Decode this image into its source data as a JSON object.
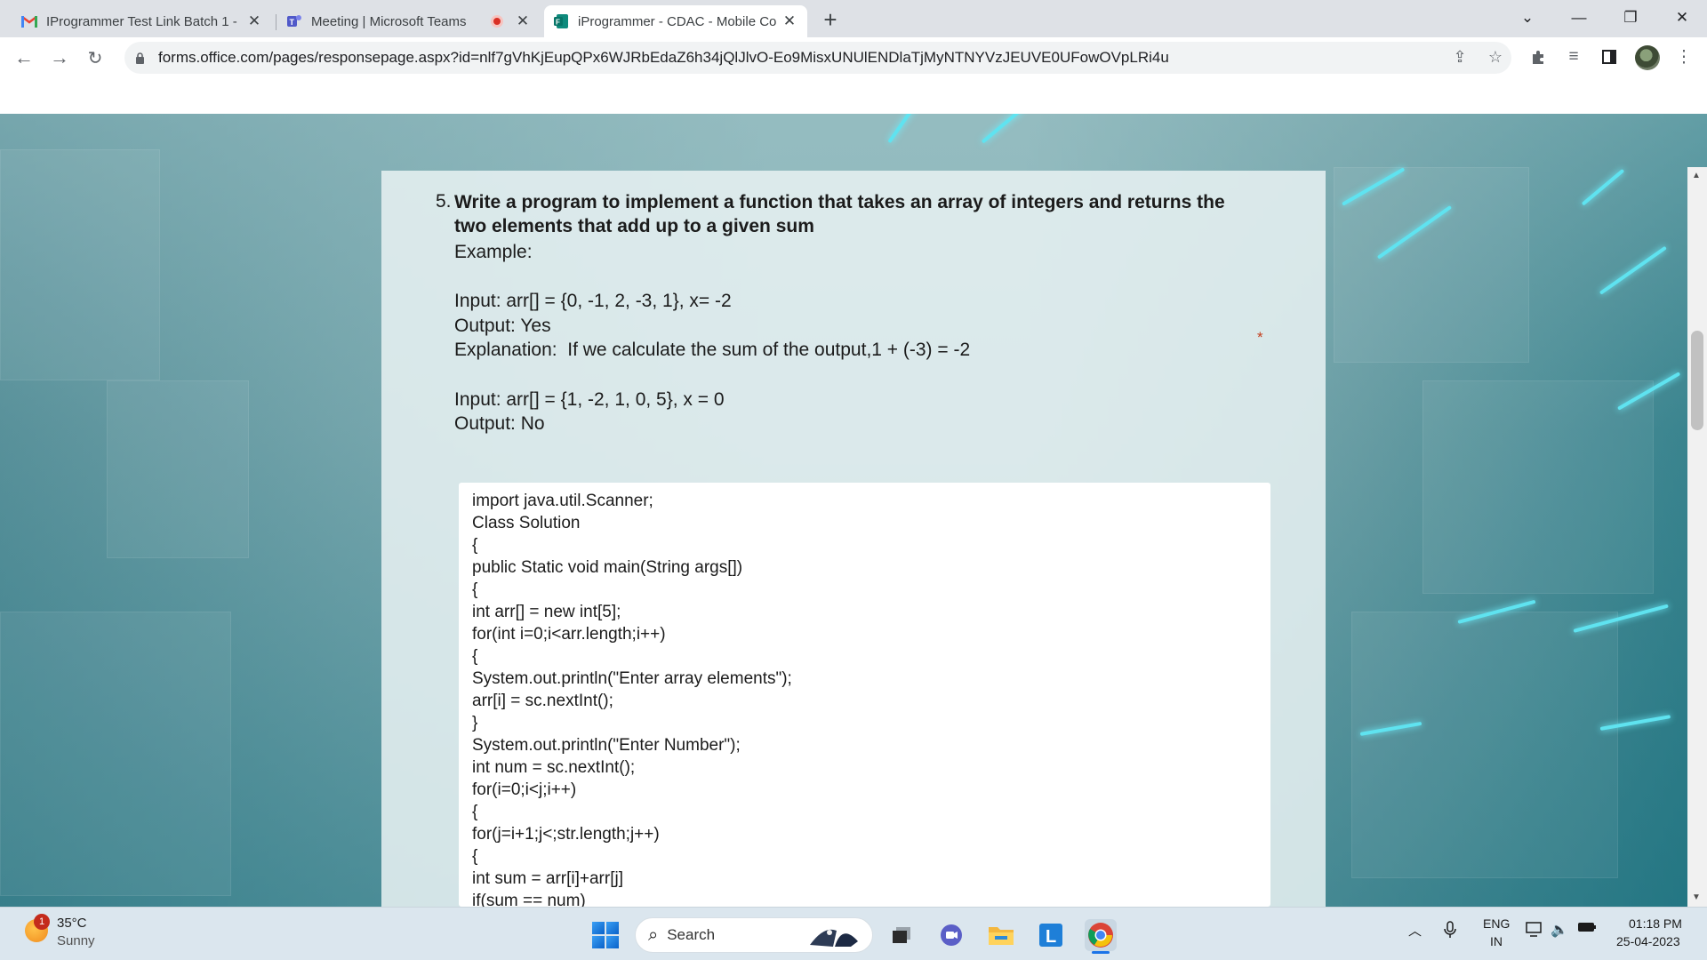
{
  "browser": {
    "tabs": [
      {
        "title": "IProgrammer Test Link Batch 1 - ",
        "icon": "gmail-icon"
      },
      {
        "title": "Meeting | Microsoft Teams",
        "icon": "teams-icon"
      },
      {
        "title": "iProgrammer - CDAC - Mobile Co",
        "icon": "forms-icon"
      }
    ],
    "url": "forms.office.com/pages/responsepage.aspx?id=nlf7gVhKjEupQPx6WJRbEdaZ6h34jQlJlvO-Eo9MisxUNUlENDlaTjMyNTNYVzJEUVE0UFowOVpLRi4u"
  },
  "question": {
    "number": "5.",
    "title": "Write a program to implement a function that takes an array of integers and returns the two elements that add up to a given sum",
    "lines": [
      "Example:",
      "Input: arr[] = {0, -1, 2, -3, 1}, x= -2",
      "Output: Yes",
      "Explanation:  If we calculate the sum of the output,1 + (-3) = -2",
      "Input: arr[] = {1, -2, 1, 0, 5}, x = 0",
      "Output: No"
    ],
    "required_mark": "*"
  },
  "answer": {
    "code_lines": [
      "import java.util.Scanner;",
      "Class Solution",
      "{",
      "public Static void main(String args[])",
      "{",
      "int arr[] = new int[5];",
      "for(int i=0;i<arr.length;i++)",
      "{",
      "System.out.println(\"Enter array elements\");",
      "arr[i] = sc.nextInt();",
      "}",
      "System.out.println(\"Enter Number\");",
      "int num = sc.nextInt();",
      "for(i=0;i<j;i++)",
      "{",
      "for(j=i+1;j<;str.length;j++)",
      "{",
      "int sum = arr[i]+arr[j]",
      "if(sum == num)"
    ]
  },
  "taskbar": {
    "weather_temp": "35°C",
    "weather_cond": "Sunny",
    "weather_badge": "1",
    "search_label": "Search",
    "lang": "ENG",
    "region": "IN",
    "time": "01:18 PM",
    "date": "25-04-2023"
  },
  "colors": {
    "accent": "#1a73e8",
    "required": "#c43e1c",
    "card": "#e6f0f1"
  }
}
